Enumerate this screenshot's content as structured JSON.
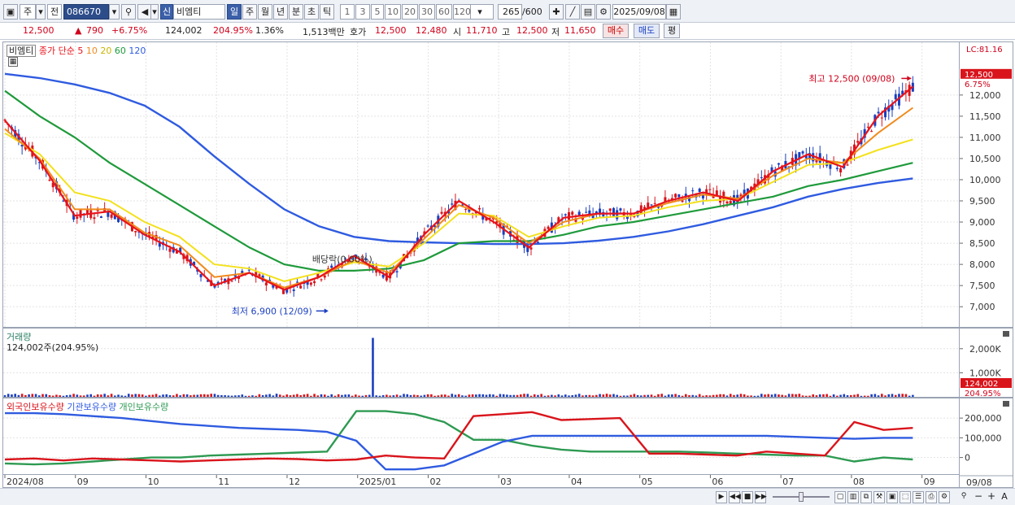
{
  "toolbar": {
    "period_label": "주",
    "prev_label": "전",
    "code": "086670",
    "market_tag": "신",
    "stock_name": "비엠티",
    "periods": [
      "일",
      "주",
      "월",
      "년",
      "분",
      "초",
      "틱"
    ],
    "active_period": "일",
    "intervals": [
      "1",
      "3",
      "5",
      "10",
      "20",
      "30",
      "60",
      "120"
    ],
    "count": "265",
    "count_total": "/600",
    "date": "2025/09/08"
  },
  "quote": {
    "price": "12,500",
    "change": "790",
    "change_pct": "+6.75%",
    "volume": "124,002",
    "volume_ratio": "204.95%",
    "turnover": "1.36%",
    "trade_value": "1,513백만",
    "bid_label": "호가",
    "ask": "12,500",
    "bid": "12,480",
    "open_label": "시",
    "open": "11,710",
    "high_label": "고",
    "high": "12,500",
    "low_label": "저",
    "low": "11,650",
    "buy_label": "매수",
    "sell_label": "매도",
    "flat_label": "평"
  },
  "price_panel": {
    "legend_name": "비엠티",
    "legend_ma_label": "종가 단순",
    "ma_periods": [
      "5",
      "10",
      "20",
      "60",
      "120"
    ],
    "ma_colors": [
      "#e8131b",
      "#f08a1c",
      "#f3e11d",
      "#1f9a3b",
      "#2f5be0"
    ],
    "axis_top_label": "LC:81.16",
    "current_price_tag": "12,500",
    "current_pct_tag": "6.75%",
    "high_annotation": "최고 12,500 (09/08)",
    "low_annotation": "최저 6,900 (12/09)",
    "dividend_annotation": "배당락(0.00%)"
  },
  "volume_panel": {
    "title": "거래량",
    "summary": "124,002주(204.95%)",
    "current_tag": "124,002",
    "ratio_tag": "204.95%",
    "axis_labels": [
      "2,000K",
      "1,000K"
    ]
  },
  "holding_panel": {
    "legend": [
      "외국인보유수량",
      "기관보유수량",
      "개인보유수량"
    ],
    "colors": [
      "#d9141b",
      "#2f5be0",
      "#2e9a52"
    ],
    "axis_labels": [
      "200,000",
      "100,000",
      "0"
    ]
  },
  "date_axis": {
    "labels": [
      "2024/08",
      "09",
      "10",
      "11",
      "12",
      "2025/01",
      "02",
      "03",
      "04",
      "05",
      "06",
      "07",
      "08",
      "09"
    ],
    "right_label": "09/08"
  },
  "chart_data": {
    "type": "line",
    "title": "",
    "x": [
      "2024/08",
      "09",
      "10",
      "11",
      "12",
      "2025/01",
      "02",
      "03",
      "04",
      "05",
      "06",
      "07",
      "08",
      "09"
    ],
    "ylim": [
      6600,
      12900
    ],
    "price_ticks": [
      12000,
      11500,
      11000,
      10500,
      10000,
      9500,
      9000,
      8500,
      8000,
      7500,
      7000
    ],
    "series": [
      {
        "name": "5",
        "values": [
          11400,
          10450,
          9150,
          9250,
          8700,
          8300,
          7500,
          7800,
          7400,
          7700,
          8200,
          7700,
          8700,
          9500,
          9000,
          8400,
          9100,
          9200,
          9200,
          9500,
          9700,
          9500,
          10200,
          10600,
          10300,
          11500,
          12200
        ]
      },
      {
        "name": "10",
        "values": [
          11200,
          10500,
          9300,
          9300,
          8750,
          8450,
          7700,
          7800,
          7450,
          7700,
          8100,
          7800,
          8600,
          9400,
          9100,
          8500,
          9000,
          9200,
          9200,
          9450,
          9650,
          9550,
          10100,
          10500,
          10400,
          11100,
          11700
        ]
      },
      {
        "name": "20",
        "values": [
          11100,
          10600,
          9700,
          9500,
          9000,
          8650,
          8000,
          7900,
          7600,
          7800,
          8050,
          7950,
          8500,
          9200,
          9150,
          8650,
          8900,
          9100,
          9150,
          9350,
          9500,
          9550,
          9950,
          10350,
          10400,
          10700,
          10950
        ]
      },
      {
        "name": "60",
        "values": [
          12100,
          11500,
          11000,
          10400,
          9900,
          9400,
          8900,
          8400,
          8000,
          7850,
          7850,
          7900,
          8100,
          8500,
          8550,
          8550,
          8700,
          8900,
          9000,
          9150,
          9300,
          9450,
          9600,
          9850,
          10000,
          10200,
          10400
        ]
      },
      {
        "name": "120",
        "values": [
          12500,
          12400,
          12250,
          12050,
          11750,
          11250,
          10550,
          9900,
          9300,
          8900,
          8650,
          8550,
          8520,
          8500,
          8480,
          8480,
          8500,
          8560,
          8650,
          8780,
          8950,
          9150,
          9350,
          9600,
          9780,
          9920,
          10030
        ]
      }
    ],
    "volume_max": 2500000,
    "volume_spike_value": 2450000,
    "volume_spike_position": 0.405,
    "holdings": {
      "axis_ticks": [
        200000,
        100000,
        0
      ],
      "foreign": [
        -10000,
        -5000,
        -15000,
        -5000,
        -10000,
        -15000,
        -20000,
        -15000,
        -10000,
        -5000,
        -8000,
        -15000,
        -10000,
        10000,
        0,
        -5000,
        210000,
        220000,
        230000,
        190000,
        195000,
        200000,
        20000,
        20000,
        15000,
        10000,
        30000,
        20000,
        10000,
        180000,
        140000,
        150000
      ],
      "institution": [
        225000,
        225000,
        220000,
        210000,
        200000,
        185000,
        170000,
        160000,
        150000,
        145000,
        140000,
        130000,
        85000,
        -60000,
        -60000,
        -40000,
        20000,
        80000,
        110000,
        110000,
        110000,
        110000,
        110000,
        110000,
        110000,
        110000,
        110000,
        105000,
        100000,
        95000,
        100000,
        100000
      ],
      "individual": [
        -30000,
        -35000,
        -30000,
        -20000,
        -10000,
        0,
        0,
        10000,
        15000,
        20000,
        25000,
        30000,
        235000,
        235000,
        220000,
        180000,
        90000,
        90000,
        60000,
        40000,
        30000,
        30000,
        30000,
        30000,
        25000,
        20000,
        15000,
        10000,
        10000,
        -20000,
        0,
        -10000
      ]
    }
  }
}
